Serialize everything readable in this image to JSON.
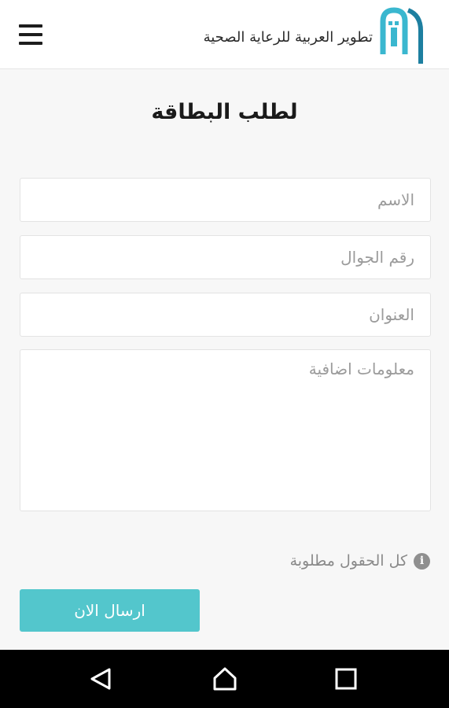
{
  "header": {
    "brand_name": "تطوير العربية للرعاية الصحية",
    "menu_icon": "hamburger-menu-icon",
    "logo_icon": "brand-logo-icon",
    "brand_color": "#3aa3bd"
  },
  "form": {
    "title": "لطلب البطاقة",
    "name_placeholder": "الاسم",
    "phone_placeholder": "رقم الجوال",
    "address_placeholder": "العنوان",
    "extra_placeholder": "معلومات اضافية",
    "required_note": "كل الحقول مطلوبة",
    "info_icon": "info-icon",
    "info_glyph": "i",
    "submit_label": "ارسال الان",
    "accent_color": "#53c6cc"
  },
  "navbar": {
    "back_icon": "back-triangle-icon",
    "home_icon": "home-icon",
    "recents_icon": "recents-square-icon"
  }
}
